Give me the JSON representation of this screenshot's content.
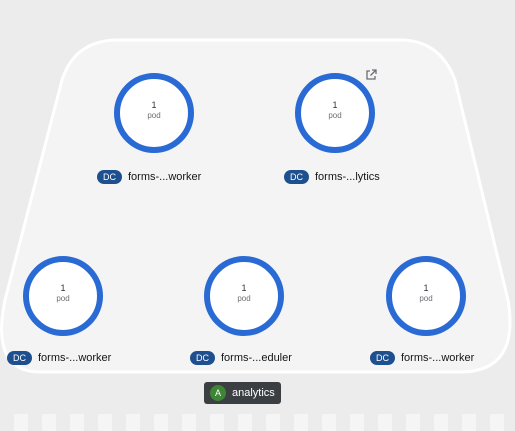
{
  "group": {
    "badge": "A",
    "label": "analytics"
  },
  "nodes": [
    {
      "badge": "DC",
      "name": "forms-...worker",
      "pod_count": "1",
      "pod_unit": "pod"
    },
    {
      "badge": "DC",
      "name": "forms-...lytics",
      "pod_count": "1",
      "pod_unit": "pod"
    },
    {
      "badge": "DC",
      "name": "forms-...worker",
      "pod_count": "1",
      "pod_unit": "pod"
    },
    {
      "badge": "DC",
      "name": "forms-...eduler",
      "pod_count": "1",
      "pod_unit": "pod"
    },
    {
      "badge": "DC",
      "name": "forms-...worker",
      "pod_count": "1",
      "pod_unit": "pod"
    }
  ],
  "icons": {
    "external_link": "external-link-icon"
  },
  "colors": {
    "ring": "#2a6ad4",
    "dc_badge": "#1e4f8f",
    "group_badge": "#3e8635",
    "group_label_bg": "#3c3f42",
    "group_fill": "#f4f4f4",
    "background": "#ececec"
  }
}
